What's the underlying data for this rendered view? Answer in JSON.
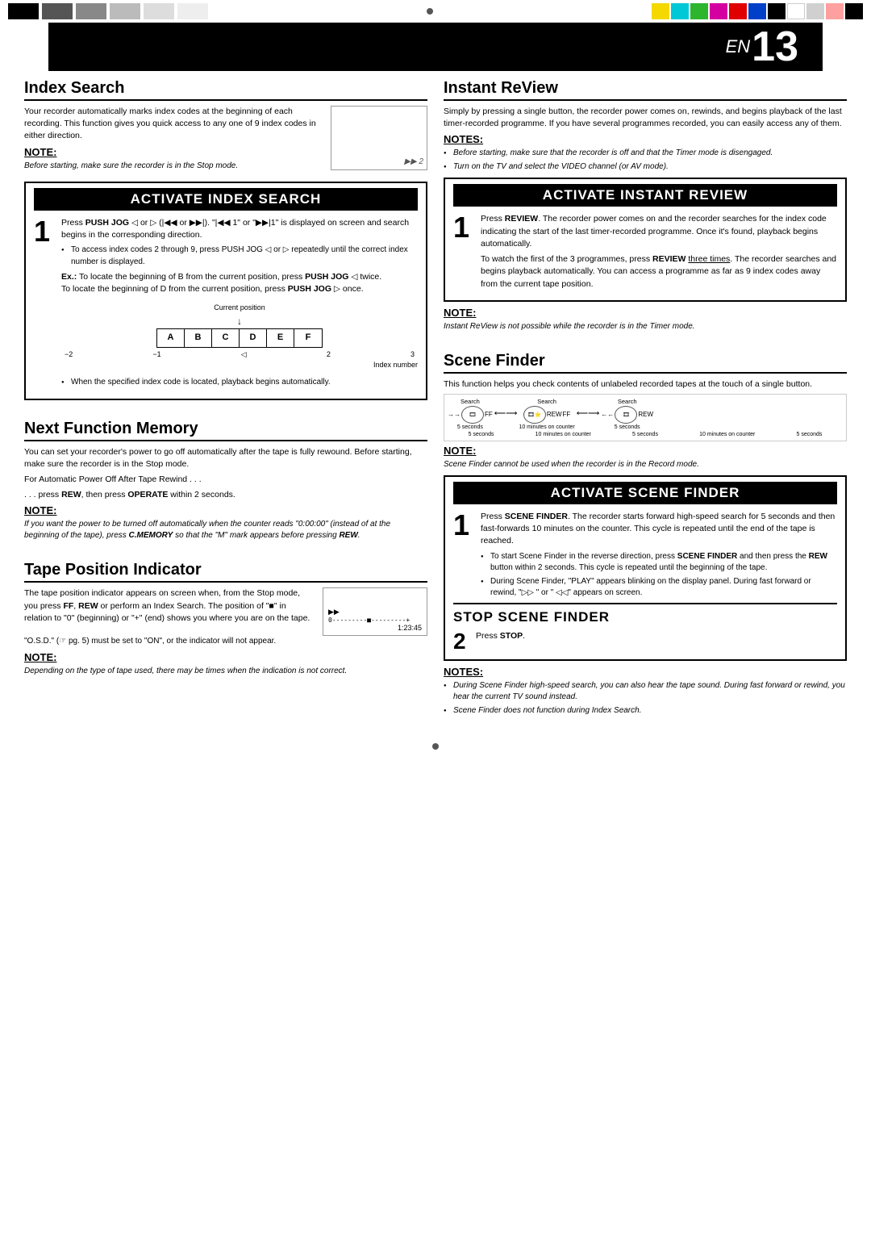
{
  "topBar": {
    "colorBlocks": [
      "#1a1a1a",
      "#555",
      "#888",
      "#aaa",
      "#ccc",
      "#e8e8e8"
    ],
    "swatches": [
      "#f5d800",
      "#00c8d7",
      "#2db52d",
      "#d400a0",
      "#e00000",
      "#0040c8",
      "#000",
      "#fff",
      "#d0d0d0",
      "#ffa0a0",
      "#000"
    ]
  },
  "page": {
    "en": "EN",
    "number": "13"
  },
  "indexSearch": {
    "title": "Index Search",
    "body": "Your recorder automatically marks index codes at the beginning of each recording. This function gives you quick access to any one of 9 index codes in either direction.",
    "note_heading": "NOTE:",
    "note_text": "Before starting, make sure the recorder is in the Stop mode.",
    "activate_title": "ACTIVATE INDEX SEARCH",
    "step1_text": "Press PUSH JOG ◁ or ▷ (|◀◀ or ▶▶|). \"|◀◀ 1\" or \"▶▶|1\" is displayed on screen and search begins in the corresponding direction.",
    "bullet1": "To access index codes 2 through 9, press PUSH JOG ◁ or ▷ repeatedly until the correct index number is displayed.",
    "example_label": "Ex.:",
    "example1": "To locate the beginning of B from the current position, press PUSH JOG ◁ twice.",
    "example2": "To locate the beginning of D from the current position, press PUSH JOG ▷ once.",
    "current_pos": "Current position",
    "abcdef": [
      "A",
      "B",
      "C",
      "D",
      "E",
      "F"
    ],
    "numbers": [
      "-2",
      "-1",
      "",
      "2",
      "3"
    ],
    "index_number": "Index number",
    "bullet2": "When the specified index code is located, playback begins automatically."
  },
  "nextFunctionMemory": {
    "title": "Next Function Memory",
    "body": "You can set your recorder's power to go off automatically after the tape is fully rewound. Before starting, make sure the recorder is in the Stop mode.",
    "line2": "For Automatic Power Off After Tape Rewind . . .",
    "line3": ". . . press REW, then press OPERATE within 2 seconds.",
    "note_heading": "NOTE:",
    "note_italic": "If you want the power to be turned off automatically when the counter reads \"0:00:00\" (instead of at the beginning of the tape), press C.MEMORY so that the \"M\" mark appears before pressing REW."
  },
  "tapePositionIndicator": {
    "title": "Tape Position Indicator",
    "body1": "The tape position indicator appears on screen when, from the Stop mode, you press FF, REW or perform an Index Search. The position of \"■\" in relation to \"0\" (beginning) or \"+\" (end) shows you where you are on the tape.",
    "tape_bar": "0---------■---------+",
    "tape_time": "1:23:45",
    "body2": "\"O.S.D.\" (☞ pg. 5) must be set to \"ON\", or the indicator will not appear.",
    "note_heading": "NOTE:",
    "note_italic": "Depending on the type of tape used, there may be times when the indication is not correct."
  },
  "instantReview": {
    "title": "Instant ReView",
    "body": "Simply by pressing a single button, the recorder power comes on, rewinds, and begins playback of the last timer-recorded programme. If you have several programmes recorded, you can easily access any of them.",
    "notes_heading": "NOTES:",
    "note1": "Before starting, make sure that the recorder is off and that the Timer mode is disengaged.",
    "note2": "Turn on the TV and select the VIDEO channel (or AV mode).",
    "activate_title": "ACTIVATE INSTANT REVIEW",
    "step1_text": "Press REVIEW. The recorder power comes on and the recorder searches for the index code indicating the start of the last timer-recorded programme. Once it's found, playback begins automatically.",
    "step1_extra": "To watch the first of the 3 programmes, press REVIEW three times. The recorder searches and begins playback automatically. You can access a programme as far as 9 index codes away from the current tape position.",
    "note_heading2": "NOTE:",
    "note_italic2": "Instant ReView is not possible while the recorder is in the Timer mode."
  },
  "sceneFinder": {
    "title": "Scene Finder",
    "body": "This function helps you check contents of unlabeled recorded tapes at the touch of a single button.",
    "search_label": "Search",
    "ff_label": "FF",
    "rew_label": "REW",
    "times_row": [
      "5 seconds",
      "10 minutes on counter",
      "5 seconds",
      "10 minutes on counter",
      "5 seconds"
    ],
    "note_heading": "NOTE:",
    "note_italic": "Scene Finder cannot be used when the recorder is in the Record mode.",
    "activate_title": "ACTIVATE SCENE FINDER",
    "step1_text": "Press SCENE FINDER. The recorder starts forward high-speed search for 5 seconds and then fast-forwards 10 minutes on the counter. This cycle is repeated until the end of the tape is reached.",
    "bullet1": "To start Scene Finder in the reverse direction, press SCENE FINDER and then press the REW button within 2 seconds. This cycle is repeated until the beginning of the tape.",
    "bullet2": "During Scene Finder, \"PLAY\" appears blinking on the display panel. During fast forward or rewind, \" \" or \" \" appears on screen.",
    "stop_title": "STOP SCENE FINDER",
    "step2_text": "Press STOP.",
    "notes2_heading": "NOTES:",
    "notes2_1": "During Scene Finder high-speed search, you can also hear the tape sound. During fast forward or rewind, you hear the current TV sound instead.",
    "notes2_2": "Scene Finder does not function during Index Search."
  }
}
